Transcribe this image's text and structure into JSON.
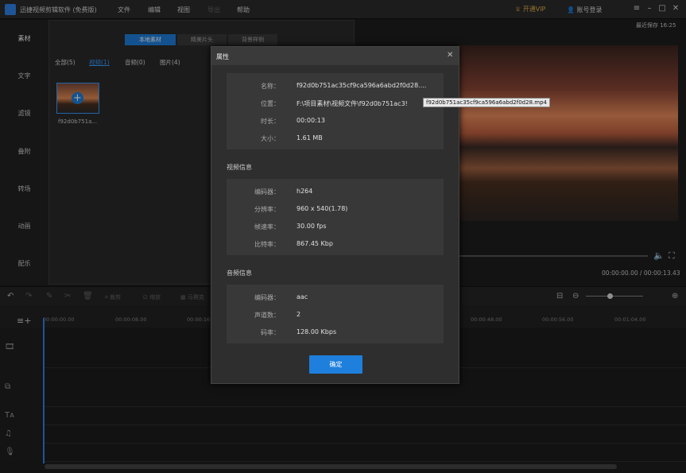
{
  "app": {
    "title": "迅捷视频剪辑软件 (免费版)",
    "menus": [
      "文件",
      "编辑",
      "视图",
      "导出",
      "帮助"
    ],
    "vip": "开通VIP",
    "login": "账号登录"
  },
  "sidebar": {
    "items": [
      "素材",
      "文字",
      "滤镜",
      "叠附",
      "转场",
      "动画",
      "配乐"
    ]
  },
  "media": {
    "segments": [
      "本地素材",
      "精美片头",
      "背景样例"
    ],
    "filters": [
      "全部(5)",
      "视频(1)",
      "音频(0)",
      "图片(4)"
    ],
    "thumb_name": "f92d0b751a..."
  },
  "preview": {
    "autosave": "最近保存 16:25",
    "time": "00:00:00.00 / 00:00:13.43"
  },
  "toolbar": {
    "labels": [
      "裁剪",
      "缩放",
      "马赛克"
    ]
  },
  "ruler": {
    "ticks": [
      "00:00:00.00",
      "00:00:08.00",
      "00:00:16",
      "00:00:48.00",
      "00:00:56.00",
      "00:01:04.00"
    ]
  },
  "dialog": {
    "title": "属性",
    "basic": [
      {
        "label": "名称：",
        "value": "f92d0b751ac35cf9ca596a6abd2f0d28...."
      },
      {
        "label": "位置：",
        "value": "F:\\项目素材\\视频文件\\f92d0b751ac3!"
      },
      {
        "label": "时长：",
        "value": "00:00:13"
      },
      {
        "label": "大小：",
        "value": "1.61 MB"
      }
    ],
    "video_title": "视频信息",
    "video": [
      {
        "label": "编码器：",
        "value": "h264"
      },
      {
        "label": "分辨率：",
        "value": "960 x 540(1.78)"
      },
      {
        "label": "帧速率：",
        "value": "30.00 fps"
      },
      {
        "label": "比特率：",
        "value": "867.45 Kbp"
      }
    ],
    "audio_title": "音频信息",
    "audio": [
      {
        "label": "编码器：",
        "value": "aac"
      },
      {
        "label": "声道数：",
        "value": "2"
      },
      {
        "label": "码率：",
        "value": "128.00 Kbps"
      }
    ],
    "ok": "确定",
    "tooltip": "f92d0b751ac35cf9ca596a6abd2f0d28.mp4"
  }
}
